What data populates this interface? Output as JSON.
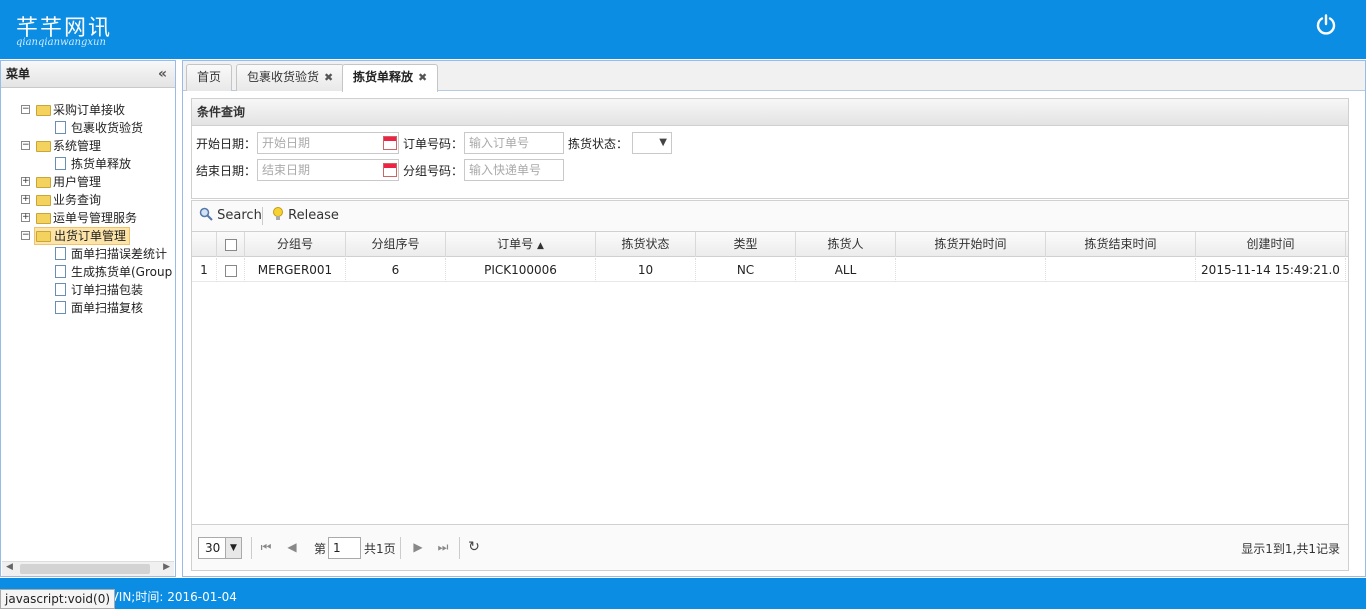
{
  "header": {
    "logo_cn": "芊芊网讯",
    "logo_en": "qianqianwangxun"
  },
  "menu": {
    "title": "菜单",
    "collapse": "«"
  },
  "tree": [
    {
      "label": "采购订单接收",
      "type": "folder",
      "tog": "−"
    },
    {
      "label": "包裹收货验货",
      "type": "doc"
    },
    {
      "label": "系统管理",
      "type": "folder",
      "tog": "−"
    },
    {
      "label": "拣货单释放",
      "type": "doc"
    },
    {
      "label": "用户管理",
      "type": "folder",
      "tog": "+"
    },
    {
      "label": "业务查询",
      "type": "folder",
      "tog": "+"
    },
    {
      "label": "运单号管理服务",
      "type": "folder",
      "tog": "+"
    },
    {
      "label": "出货订单管理",
      "type": "folder",
      "tog": "−",
      "selected": true
    },
    {
      "label": "面单扫描误差统计",
      "type": "doc"
    },
    {
      "label": "生成拣货单(Group",
      "type": "doc"
    },
    {
      "label": "订单扫描包装",
      "type": "doc"
    },
    {
      "label": "面单扫描复核",
      "type": "doc"
    }
  ],
  "tabs": [
    {
      "label": "首页",
      "closable": false,
      "active": false
    },
    {
      "label": "包裹收货验货",
      "closable": true,
      "active": false
    },
    {
      "label": "拣货单释放",
      "closable": true,
      "active": true
    }
  ],
  "query": {
    "title": "条件查询",
    "start_date_label": "开始日期：",
    "start_date_placeholder": "开始日期",
    "order_no_label": "订单号码：",
    "order_no_placeholder": "输入订单号",
    "pick_status_label": "拣货状态：",
    "pick_status_value": "",
    "end_date_label": "结束日期：",
    "end_date_placeholder": "结束日期",
    "group_no_label": "分组号码：",
    "group_no_placeholder": "输入快递单号"
  },
  "toolbar": {
    "search_label": "Search",
    "release_label": "Release"
  },
  "grid": {
    "columns": [
      "分组号",
      "分组序号",
      "订单号",
      "拣货状态",
      "类型",
      "拣货人",
      "拣货开始时间",
      "拣货结束时间",
      "创建时间"
    ],
    "sort_indicator": "▲",
    "rows": [
      {
        "num": "1",
        "group_no": "MERGER001",
        "group_seq": "6",
        "order_no": "PICK100006",
        "pick_status": "10",
        "type": "NC",
        "picker": "ALL",
        "pick_start": "",
        "pick_end": "",
        "created": "2015-11-14 15:49:21.0"
      }
    ]
  },
  "pager": {
    "page_size": "30",
    "page_prefix": "第",
    "page_value": "1",
    "page_total": "共1页",
    "summary": "显示1到1,共1记录"
  },
  "footer": {
    "text": "EVIN;时间: 2016-01-04",
    "status_tip": "javascript:void(0)"
  },
  "colors": {
    "header_bg": "#0a8de3",
    "border": "#99bbe8",
    "selected_node": "#fce3a8"
  }
}
